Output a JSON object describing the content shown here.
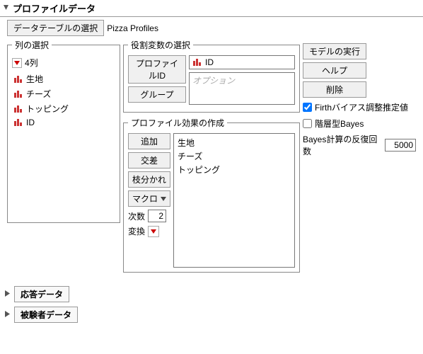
{
  "profile": {
    "title": "プロファイルデータ",
    "table_select_btn": "データテーブルの選択",
    "table_name": "Pizza Profiles"
  },
  "columns": {
    "legend": "列の選択",
    "count_label": "4列",
    "items": [
      "生地",
      "チーズ",
      "トッピング",
      "ID"
    ]
  },
  "roles": {
    "legend": "役割変数の選択",
    "profile_id_btn": "プロファイルID",
    "profile_id_value": "ID",
    "group_btn": "グループ",
    "group_placeholder": "オプション"
  },
  "actions": {
    "run": "モデルの実行",
    "help": "ヘルプ",
    "remove": "削除",
    "firth_label": "Firthバイアス調整推定値",
    "firth_checked": true,
    "hier_label": "階層型Bayes",
    "hier_checked": false,
    "iter_label": "Bayes計算の反復回数",
    "iter_value": "5000"
  },
  "effects": {
    "legend": "プロファイル効果の作成",
    "add": "追加",
    "cross": "交差",
    "nest": "枝分かれ",
    "macro": "マクロ",
    "degree_label": "次数",
    "degree_value": "2",
    "transform_label": "変換",
    "items": [
      "生地",
      "チーズ",
      "トッピング"
    ]
  },
  "collapsed": {
    "response": "応答データ",
    "subject": "被験者データ"
  }
}
